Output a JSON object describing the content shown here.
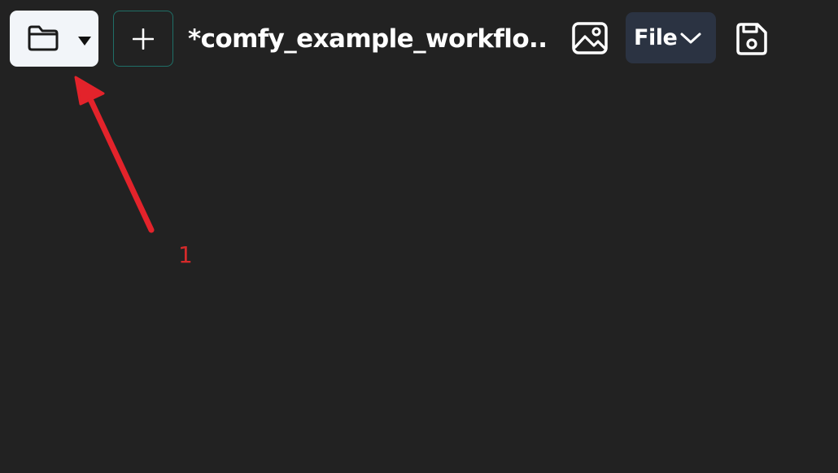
{
  "toolbar": {
    "workflow_title": "*comfy_example_workflo...",
    "file_menu_label": "File",
    "icons": {
      "folder": "folder-icon",
      "dropdown": "caret-down-icon",
      "new": "plus-icon",
      "image": "image-icon",
      "chevron": "chevron-down-icon",
      "save": "save-icon"
    }
  },
  "annotation": {
    "number": "1",
    "color": "#d42a2a"
  },
  "colors": {
    "background": "#222222",
    "folder_button": "#f2f5f9",
    "new_button_border": "#1f6f67",
    "file_button": "#2b3342"
  }
}
